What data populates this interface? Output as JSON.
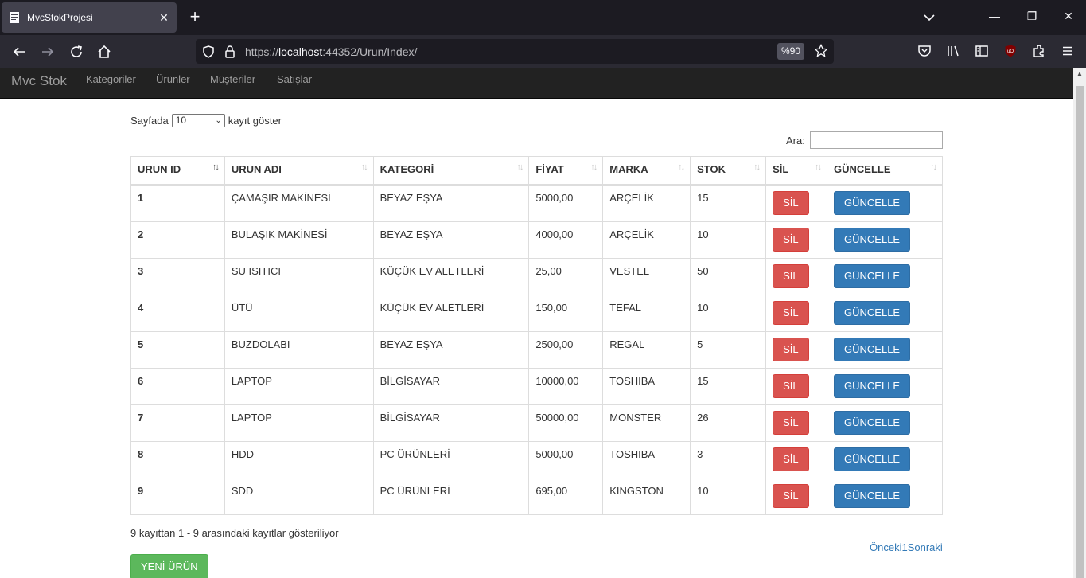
{
  "browser": {
    "tab_title": "MvcStokProjesi",
    "url_prefix": "https://",
    "url_host": "localhost",
    "url_rest": ":44352/Urun/Index/",
    "zoom": "%90"
  },
  "site": {
    "brand": "Mvc Stok",
    "nav": [
      "Kategoriler",
      "Ürünler",
      "Müşteriler",
      "Satışlar"
    ]
  },
  "controls": {
    "length_prefix": "Sayfada",
    "length_value": "10",
    "length_suffix": "kayıt göster",
    "search_label": "Ara:",
    "search_value": ""
  },
  "table": {
    "headers": [
      "URUN ID",
      "URUN ADI",
      "KATEGORİ",
      "FİYAT",
      "MARKA",
      "STOK",
      "SİL",
      "GÜNCELLE"
    ],
    "delete_label": "SİL",
    "update_label": "GÜNCELLE",
    "rows": [
      {
        "id": "1",
        "name": "ÇAMAŞIR MAKİNESİ",
        "category": "BEYAZ EŞYA",
        "price": "5000,00",
        "brand": "ARÇELİK",
        "stock": "15"
      },
      {
        "id": "2",
        "name": "BULAŞIK MAKİNESİ",
        "category": "BEYAZ EŞYA",
        "price": "4000,00",
        "brand": "ARÇELİK",
        "stock": "10"
      },
      {
        "id": "3",
        "name": "SU ISITICI",
        "category": "KÜÇÜK EV ALETLERİ",
        "price": "25,00",
        "brand": "VESTEL",
        "stock": "50"
      },
      {
        "id": "4",
        "name": "ÜTÜ",
        "category": "KÜÇÜK EV ALETLERİ",
        "price": "150,00",
        "brand": "TEFAL",
        "stock": "10"
      },
      {
        "id": "5",
        "name": "BUZDOLABI",
        "category": "BEYAZ EŞYA",
        "price": "2500,00",
        "brand": "REGAL",
        "stock": "5"
      },
      {
        "id": "6",
        "name": "LAPTOP",
        "category": "BİLGİSAYAR",
        "price": "10000,00",
        "brand": "TOSHIBA",
        "stock": "15"
      },
      {
        "id": "7",
        "name": "LAPTOP",
        "category": "BİLGİSAYAR",
        "price": "50000,00",
        "brand": "MONSTER",
        "stock": "26"
      },
      {
        "id": "8",
        "name": "HDD",
        "category": "PC ÜRÜNLERİ",
        "price": "5000,00",
        "brand": "TOSHIBA",
        "stock": "3"
      },
      {
        "id": "9",
        "name": "SDD",
        "category": "PC ÜRÜNLERİ",
        "price": "695,00",
        "brand": "KINGSTON",
        "stock": "10"
      }
    ]
  },
  "footer": {
    "info": "9 kayıttan 1 - 9 arasındaki kayıtlar gösteriliyor",
    "prev": "Önceki",
    "page": "1",
    "next": "Sonraki",
    "new_button": "YENİ ÜRÜN"
  }
}
